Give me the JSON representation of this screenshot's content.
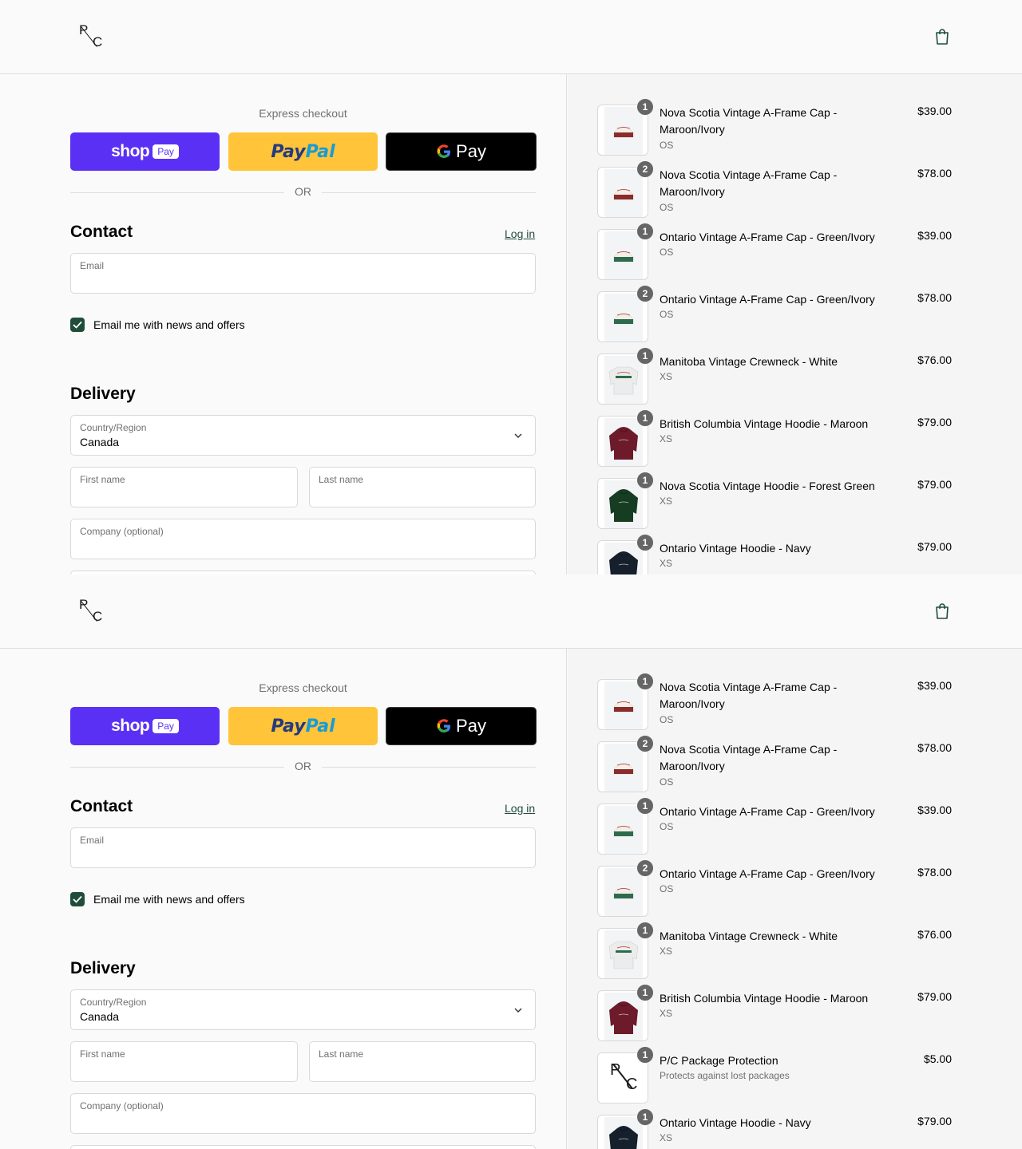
{
  "header": {
    "logo_top": "P",
    "logo_bottom": "C",
    "cart_icon": "shopping-bag-icon"
  },
  "express": {
    "label": "Express checkout",
    "shop_pay": {
      "word": "shop",
      "badge": "Pay"
    },
    "paypal": {
      "part1": "Pay",
      "part2": "Pal"
    },
    "gpay": {
      "g": "G",
      "text": "Pay"
    },
    "or_label": "OR"
  },
  "contact": {
    "heading": "Contact",
    "login_label": "Log in",
    "email_label": "Email",
    "email_value": "",
    "newsletter_label": "Email me with news and offers",
    "newsletter_checked": true
  },
  "delivery": {
    "heading": "Delivery",
    "country_label": "Country/Region",
    "country_value": "Canada",
    "first_name_label": "First name",
    "last_name_label": "Last name",
    "company_label": "Company (optional)"
  },
  "frames": [
    {
      "items": [
        {
          "qty": "1",
          "name": "Nova Scotia Vintage A-Frame Cap - Maroon/Ivory",
          "variant": "OS",
          "price": "$39.00",
          "kind": "cap-maroon"
        },
        {
          "qty": "2",
          "name": "Nova Scotia Vintage A-Frame Cap - Maroon/Ivory",
          "variant": "OS",
          "price": "$78.00",
          "kind": "cap-maroon"
        },
        {
          "qty": "1",
          "name": "Ontario Vintage A-Frame Cap - Green/Ivory",
          "variant": "OS",
          "price": "$39.00",
          "kind": "cap-green"
        },
        {
          "qty": "2",
          "name": "Ontario Vintage A-Frame Cap - Green/Ivory",
          "variant": "OS",
          "price": "$78.00",
          "kind": "cap-green"
        },
        {
          "qty": "1",
          "name": "Manitoba Vintage Crewneck - White",
          "variant": "XS",
          "price": "$76.00",
          "kind": "crew-white"
        },
        {
          "qty": "1",
          "name": "British Columbia Vintage Hoodie - Maroon",
          "variant": "XS",
          "price": "$79.00",
          "kind": "hoodie-maroon"
        },
        {
          "qty": "1",
          "name": "Nova Scotia Vintage Hoodie - Forest Green",
          "variant": "XS",
          "price": "$79.00",
          "kind": "hoodie-green"
        },
        {
          "qty": "1",
          "name": "Ontario Vintage Hoodie - Navy",
          "variant": "XS",
          "price": "$79.00",
          "kind": "hoodie-navy"
        }
      ]
    },
    {
      "items": [
        {
          "qty": "1",
          "name": "Nova Scotia Vintage A-Frame Cap - Maroon/Ivory",
          "variant": "OS",
          "price": "$39.00",
          "kind": "cap-maroon"
        },
        {
          "qty": "2",
          "name": "Nova Scotia Vintage A-Frame Cap - Maroon/Ivory",
          "variant": "OS",
          "price": "$78.00",
          "kind": "cap-maroon"
        },
        {
          "qty": "1",
          "name": "Ontario Vintage A-Frame Cap - Green/Ivory",
          "variant": "OS",
          "price": "$39.00",
          "kind": "cap-green"
        },
        {
          "qty": "2",
          "name": "Ontario Vintage A-Frame Cap - Green/Ivory",
          "variant": "OS",
          "price": "$78.00",
          "kind": "cap-green"
        },
        {
          "qty": "1",
          "name": "Manitoba Vintage Crewneck - White",
          "variant": "XS",
          "price": "$76.00",
          "kind": "crew-white"
        },
        {
          "qty": "1",
          "name": "British Columbia Vintage Hoodie - Maroon",
          "variant": "XS",
          "price": "$79.00",
          "kind": "hoodie-maroon"
        },
        {
          "qty": "1",
          "name": "P/C Package Protection",
          "variant": "Protects against lost packages",
          "price": "$5.00",
          "kind": "logo"
        },
        {
          "qty": "1",
          "name": "Ontario Vintage Hoodie - Navy",
          "variant": "XS",
          "price": "$79.00",
          "kind": "hoodie-navy"
        }
      ]
    }
  ],
  "colors": {
    "brand_green": "#1f4d3a",
    "shop_pay": "#5a31f4",
    "paypal_yellow": "#ffc439",
    "gpay_black": "#000000"
  }
}
